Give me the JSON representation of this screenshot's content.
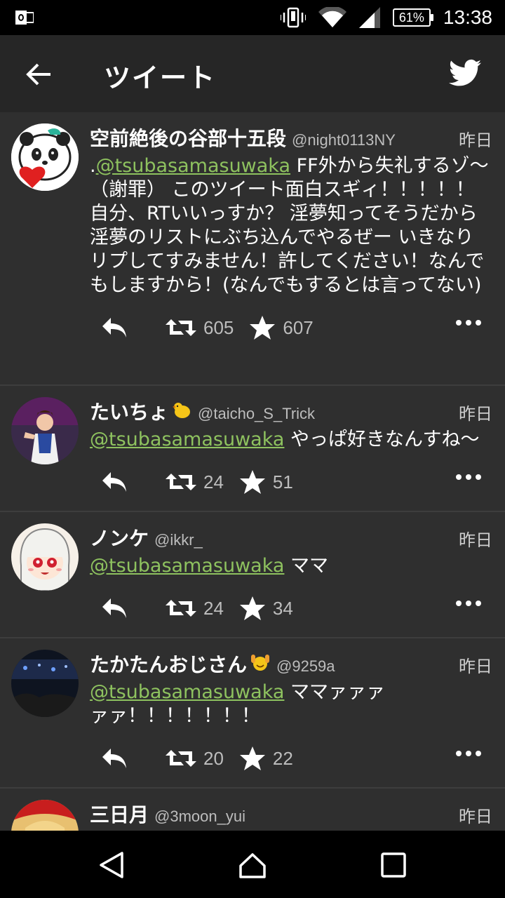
{
  "status_bar": {
    "notification_icon": "outlook-icon",
    "icons": [
      "vibrate-icon",
      "wifi-icon",
      "signal-icon"
    ],
    "battery": "61%",
    "time": "13:38"
  },
  "app_bar": {
    "title": "ツイート",
    "back_icon": "arrow-left-icon",
    "brand_icon": "twitter-bird-icon"
  },
  "tweets": [
    {
      "name": "空前絶後の谷部十五段",
      "handle": "@night0113NY",
      "date": "昨日",
      "prefix": ".",
      "mention": "@tsubasamasuwaka",
      "text": " FF外から失礼するゾ～（謝罪） このツイート面白スギィ！！！！！自分、RTいいっすか？ 淫夢知ってそうだから淫夢のリストにぶち込んでやるぜー いきなりリプしてすみません！許してください！なんでもしますから！(なんでもするとは言ってない)",
      "retweets": "605",
      "favorites": "607"
    },
    {
      "name": "たいちょ",
      "handle": "@taicho_S_Trick",
      "date": "昨日",
      "prefix": "",
      "mention": "@tsubasamasuwaka",
      "text": " やっぱ好きなんすね～",
      "retweets": "24",
      "favorites": "51"
    },
    {
      "name": "ノンケ",
      "handle": "@ikkr_",
      "date": "昨日",
      "prefix": "",
      "mention": "@tsubasamasuwaka",
      "text": " ママ",
      "retweets": "24",
      "favorites": "34"
    },
    {
      "name": "たかたんおじさん",
      "handle": "@9259a",
      "date": "昨日",
      "prefix": "",
      "mention": "@tsubasamasuwaka",
      "text": " ママァァァァァ！！！！！！！",
      "retweets": "20",
      "favorites": "22"
    },
    {
      "name": "三日月",
      "handle": "@3moon_yui",
      "date": "昨日"
    }
  ],
  "nav_bar": {
    "buttons": [
      "back-triangle-icon",
      "home-icon",
      "recents-icon"
    ]
  },
  "colors": {
    "mention": "#8ec25f",
    "background": "#2f2f2f",
    "app_bar": "#262626"
  }
}
